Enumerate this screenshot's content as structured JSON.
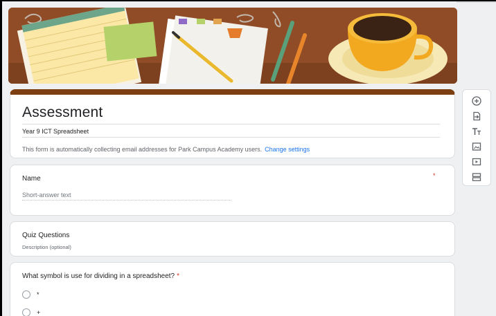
{
  "form": {
    "title": "Assessment",
    "description": "Year 9 ICT Spreadsheet",
    "notice": "This form is automatically collecting email addresses for Park Campus Academy users.",
    "notice_link": "Change settings",
    "accent_color": "#7b3f12"
  },
  "name_question": {
    "title": "Name",
    "required_marker": "*",
    "answer_placeholder": "Short-answer text"
  },
  "section": {
    "title": "Quiz Questions",
    "description": "Description (optional)"
  },
  "question": {
    "text": "What symbol is use for dividing in a spreadsheet?",
    "required_marker": "*",
    "options": [
      "*",
      "+"
    ]
  },
  "toolbar": {
    "icons": [
      "add-question-icon",
      "import-questions-icon",
      "add-title-icon",
      "add-image-icon",
      "add-video-icon",
      "add-section-icon"
    ]
  }
}
